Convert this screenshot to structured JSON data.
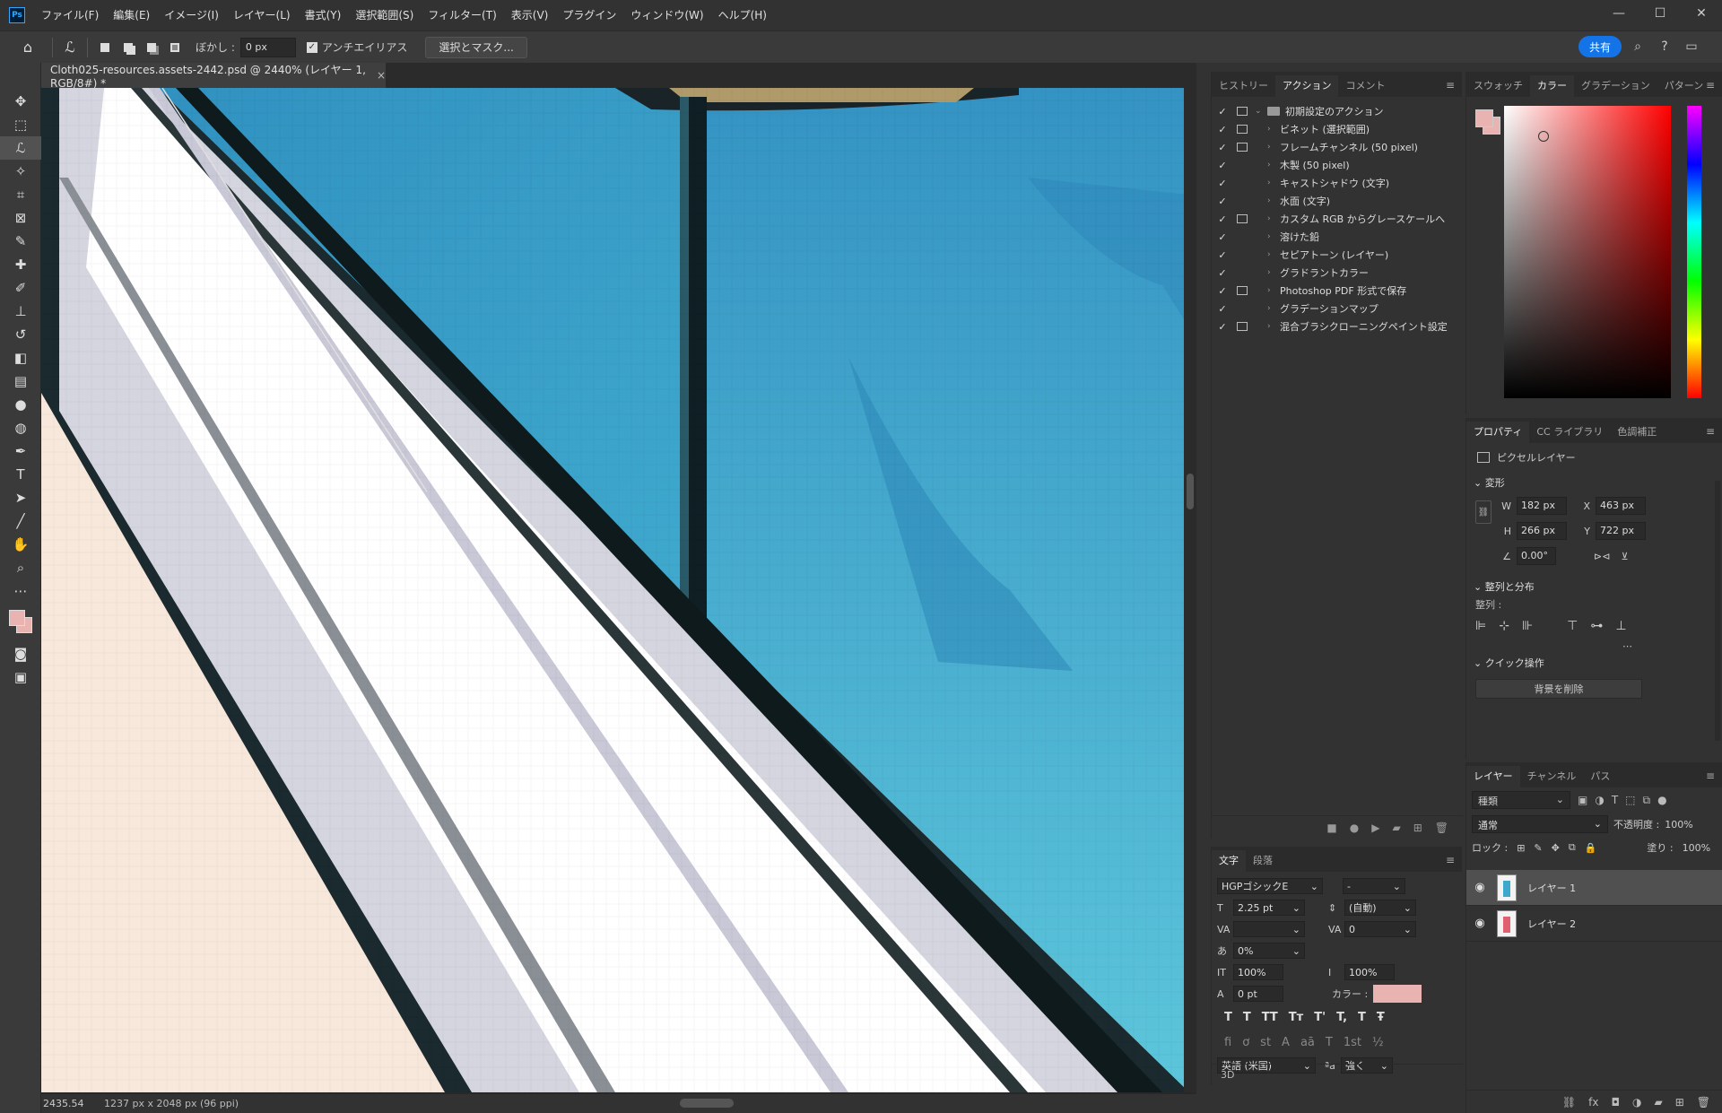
{
  "app": {
    "logo_text": "Ps"
  },
  "menu": [
    "ファイル(F)",
    "編集(E)",
    "イメージ(I)",
    "レイヤー(L)",
    "書式(Y)",
    "選択範囲(S)",
    "フィルター(T)",
    "表示(V)",
    "プラグイン",
    "ウィンドウ(W)",
    "ヘルプ(H)"
  ],
  "options_bar": {
    "feather_label": "ぼかし :",
    "feather_value": "0 px",
    "antialias_label": "アンチエイリアス",
    "select_mask_button": "選択とマスク...",
    "share_button": "共有"
  },
  "document": {
    "tab_title": "Cloth025-resources.assets-2442.psd @ 2440% (レイヤー 1, RGB/8#) *",
    "zoom": "2435.54",
    "info": "1237 px x 2048 px (96 ppi)"
  },
  "actions_panel": {
    "tabs": [
      "ヒストリー",
      "アクション",
      "コメント"
    ],
    "active_tab": "アクション",
    "items": [
      {
        "label": "初期設定のアクション",
        "dialog": true,
        "folder": true
      },
      {
        "label": "ビネット (選択範囲)",
        "dialog": true
      },
      {
        "label": "フレームチャンネル (50 pixel)",
        "dialog": true
      },
      {
        "label": "木製 (50 pixel)",
        "dialog": false
      },
      {
        "label": "キャストシャドウ (文字)",
        "dialog": false
      },
      {
        "label": "水面 (文字)",
        "dialog": false
      },
      {
        "label": "カスタム RGB からグレースケールへ",
        "dialog": true
      },
      {
        "label": "溶けた鉛",
        "dialog": false
      },
      {
        "label": "セピアトーン (レイヤー)",
        "dialog": false
      },
      {
        "label": "グラドラントカラー",
        "dialog": false
      },
      {
        "label": "Photoshop PDF 形式で保存",
        "dialog": true
      },
      {
        "label": "グラデーションマップ",
        "dialog": false
      },
      {
        "label": "混合ブラシクローニングペイント設定",
        "dialog": true
      }
    ]
  },
  "character_panel": {
    "tabs": [
      "文字",
      "段落"
    ],
    "font_family": "HGPゴシックE",
    "font_style": "-",
    "font_size": "2.25 pt",
    "leading": "(自動)",
    "kerning": "",
    "tracking": "0",
    "tsume": "0%",
    "vertical_scale": "100%",
    "horizontal_scale": "100%",
    "baseline_shift": "0 pt",
    "color_label": "カラー :",
    "color": "#e8b3b0",
    "language": "英語 (米国)",
    "antialias_label": "ªa",
    "antialias": "強く",
    "footer": "3D"
  },
  "color_panel": {
    "tabs": [
      "スウォッチ",
      "カラー",
      "グラデーション",
      "パターン"
    ],
    "active_tab": "カラー",
    "foreground": "#e8b3b0",
    "background": "#e8b3b0"
  },
  "properties_panel": {
    "tabs": [
      "プロパティ",
      "CC ライブラリ",
      "色調補正"
    ],
    "layer_type": "ピクセルレイヤー",
    "transform_title": "変形",
    "w": "182 px",
    "h": "266 px",
    "x": "463 px",
    "y": "722 px",
    "angle": "0.00°",
    "align_title": "整列と分布",
    "align_label": "整列 :",
    "quick_title": "クイック操作",
    "remove_bg_button": "背景を削除"
  },
  "layers_panel": {
    "tabs": [
      "レイヤー",
      "チャンネル",
      "パス"
    ],
    "filter_label": "種類",
    "blend_mode": "通常",
    "opacity_label": "不透明度 :",
    "opacity": "100%",
    "lock_label": "ロック :",
    "fill_label": "塗り :",
    "fill": "100%",
    "layers": [
      {
        "name": "レイヤー 1",
        "selected": true
      },
      {
        "name": "レイヤー 2",
        "selected": false
      }
    ]
  },
  "chart_data": null
}
